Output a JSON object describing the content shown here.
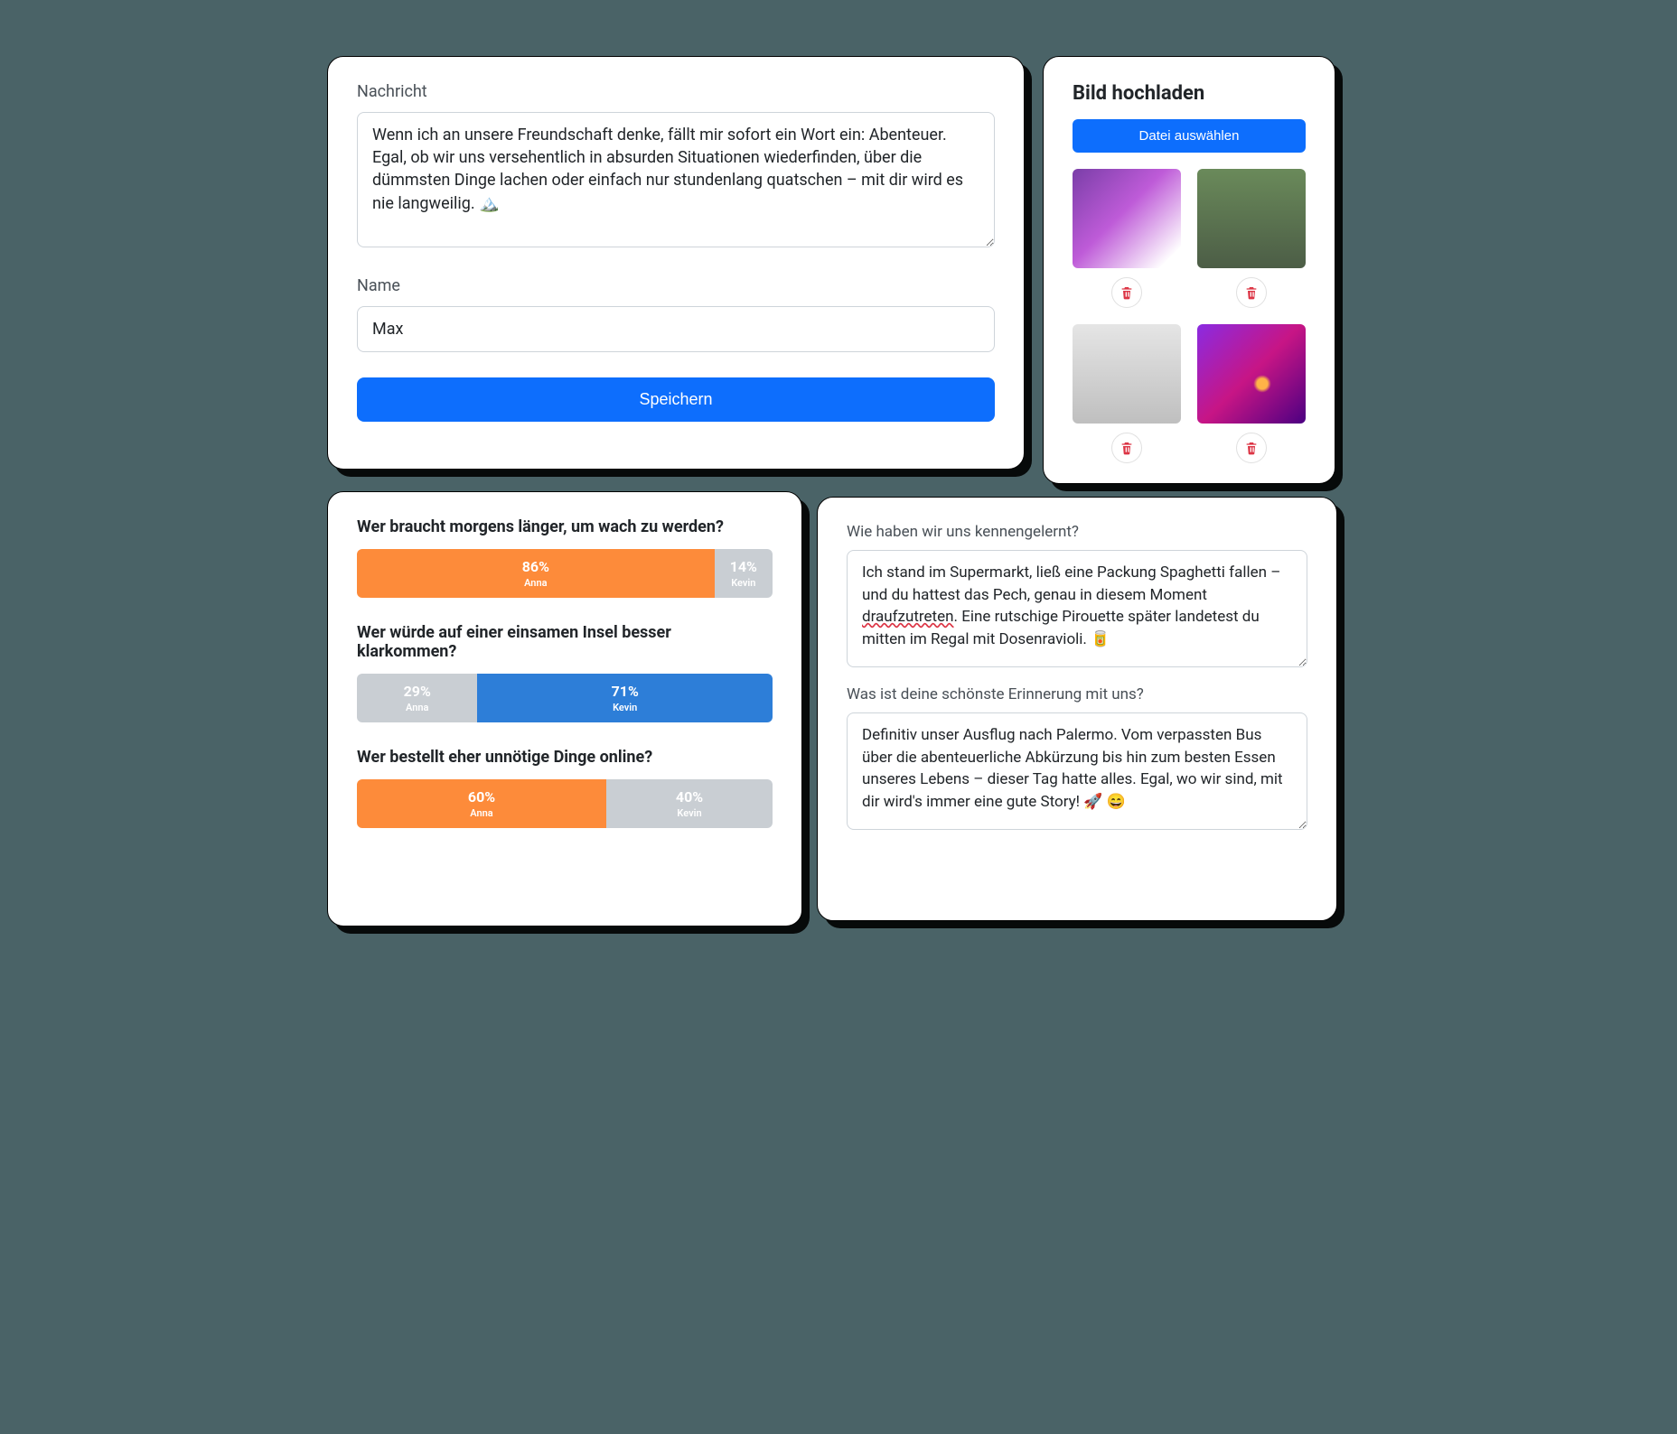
{
  "message_card": {
    "message_label": "Nachricht",
    "message_value": "Wenn ich an unsere Freundschaft denke, fällt mir sofort ein Wort ein: Abenteuer. Egal, ob wir uns versehentlich in absurden Situationen wiederfinden, über die dümmsten Dinge lachen oder einfach nur stundenlang quatschen – mit dir wird es nie langweilig. 🏔️",
    "name_label": "Name",
    "name_value": "Max",
    "save_label": "Speichern"
  },
  "upload_card": {
    "title": "Bild hochladen",
    "choose_file_label": "Datei auswählen"
  },
  "poll_card": {
    "person_a": "Anna",
    "person_b": "Kevin",
    "questions": [
      {
        "text": "Wer braucht morgens länger, um wach zu werden?",
        "a_pct": "86%",
        "b_pct": "14%",
        "a_w": 86,
        "b_w": 14,
        "a_color": "orange",
        "b_color": "gray"
      },
      {
        "text": "Wer würde auf einer einsamen Insel besser klarkommen?",
        "a_pct": "29%",
        "b_pct": "71%",
        "a_w": 29,
        "b_w": 71,
        "a_color": "gray",
        "b_color": "blue"
      },
      {
        "text": "Wer bestellt eher unnötige Dinge online?",
        "a_pct": "60%",
        "b_pct": "40%",
        "a_w": 60,
        "b_w": 40,
        "a_color": "orange",
        "b_color": "gray"
      }
    ]
  },
  "qa_card": {
    "q1_label": "Wie haben wir uns kennengelernt?",
    "q1_value_pre": "Ich stand im Supermarkt, ließ eine Packung Spaghetti fallen – und du hattest das Pech, genau in diesem Moment ",
    "q1_value_err": "draufzutreten",
    "q1_value_post": ". Eine rutschige Pirouette später landetest du mitten im Regal mit Dosenravioli. 🥫",
    "q2_label": "Was ist deine schönste Erinnerung mit uns?",
    "q2_value": "Definitiv unser Ausflug nach Palermo. Vom verpassten Bus über die abenteuerliche Abkürzung bis hin zum besten Essen unseres Lebens – dieser Tag hatte alles. Egal, wo wir sind, mit dir wird's immer eine gute Story! 🚀 😄"
  },
  "chart_data": {
    "type": "bar",
    "orientation": "horizontal-stacked",
    "categories": [
      "Anna",
      "Kevin"
    ],
    "questions": [
      {
        "question": "Wer braucht morgens länger, um wach zu werden?",
        "Anna": 86,
        "Kevin": 14
      },
      {
        "question": "Wer würde auf einer einsamen Insel besser klarkommen?",
        "Anna": 29,
        "Kevin": 71
      },
      {
        "question": "Wer bestellt eher unnötige Dinge online?",
        "Anna": 60,
        "Kevin": 40
      }
    ],
    "unit": "percent",
    "range": [
      0,
      100
    ]
  }
}
